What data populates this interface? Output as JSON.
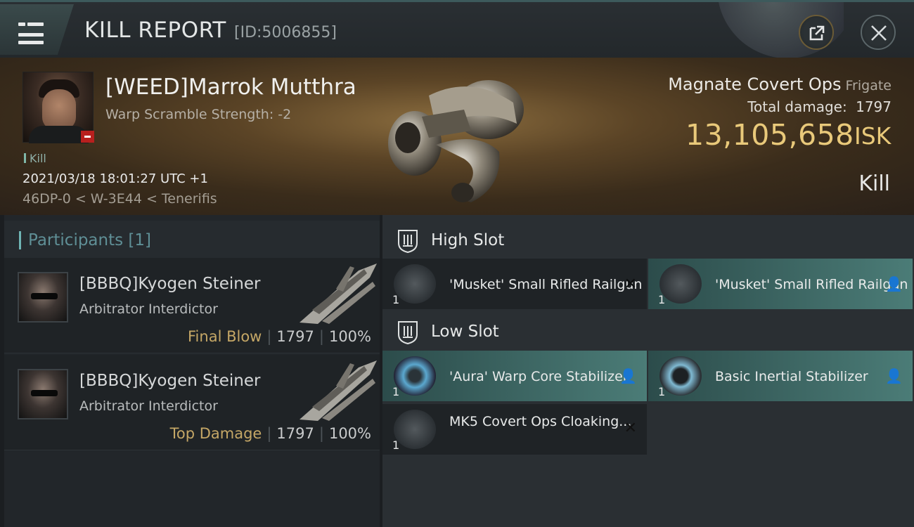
{
  "header": {
    "title": "KILL REPORT",
    "report_id": "[ID:5006855]",
    "menu_icon": "hamburger-icon",
    "export_icon": "external-link-icon",
    "close_icon": "close-icon"
  },
  "victim": {
    "name": "[WEED]Marrok Mutthra",
    "warp_scramble": "Warp Scramble Strength: -2",
    "kill_tag": "Kill",
    "timestamp": "2021/03/18 18:01:27 UTC +1",
    "location": "46DP-0 < W-3E44 < Tenerifis",
    "ship_name": "Magnate Covert Ops",
    "ship_class": "Frigate",
    "total_damage_label": "Total damage:",
    "total_damage": "1797",
    "isk_value": "13,105,658",
    "isk_unit": "ISK",
    "result": "Kill"
  },
  "participants": {
    "title": "Participants [1]",
    "items": [
      {
        "name": "[BBBQ]Kyogen Steiner",
        "ship": "Arbitrator Interdictor",
        "tag": "Final Blow",
        "damage": "1797",
        "percent": "100%"
      },
      {
        "name": "[BBBQ]Kyogen Steiner",
        "ship": "Arbitrator Interdictor",
        "tag": "Top Damage",
        "damage": "1797",
        "percent": "100%"
      }
    ]
  },
  "fitting": {
    "high_slot": {
      "title": "High Slot",
      "modules": [
        {
          "name": "'Musket' Small Rifled Railgun",
          "qty": "1",
          "status": "destroyed"
        },
        {
          "name": "'Musket' Small Rifled Railgun",
          "qty": "1",
          "status": "dropped"
        }
      ]
    },
    "low_slot": {
      "title": "Low Slot",
      "modules": [
        {
          "name": "'Aura' Warp Core Stabilizer",
          "qty": "1",
          "status": "dropped"
        },
        {
          "name": "Basic Inertial Stabilizer",
          "qty": "1",
          "status": "dropped"
        },
        {
          "name": "MK5 Covert Ops Cloaking...",
          "qty": "1",
          "status": "destroyed"
        }
      ]
    }
  },
  "colors": {
    "accent_teal": "#6fb5b5",
    "isk_gold": "#e9c97a",
    "dropped_row": "#4b7c77",
    "negative_badge": "#b8201e"
  }
}
